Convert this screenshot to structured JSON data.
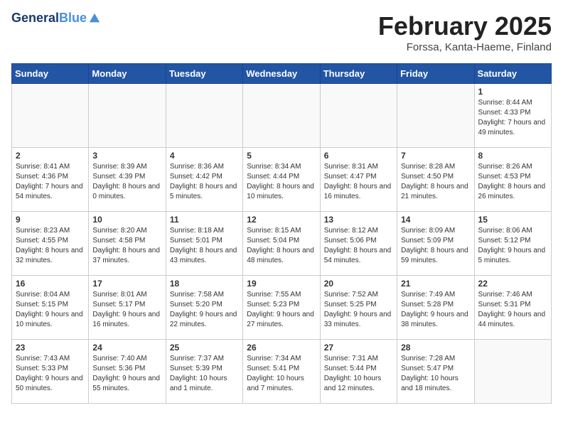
{
  "app": {
    "logo_line1": "General",
    "logo_line2": "Blue"
  },
  "calendar": {
    "title": "February 2025",
    "subtitle": "Forssa, Kanta-Haeme, Finland",
    "weekdays": [
      "Sunday",
      "Monday",
      "Tuesday",
      "Wednesday",
      "Thursday",
      "Friday",
      "Saturday"
    ],
    "weeks": [
      [
        {
          "day": "",
          "info": ""
        },
        {
          "day": "",
          "info": ""
        },
        {
          "day": "",
          "info": ""
        },
        {
          "day": "",
          "info": ""
        },
        {
          "day": "",
          "info": ""
        },
        {
          "day": "",
          "info": ""
        },
        {
          "day": "1",
          "info": "Sunrise: 8:44 AM\nSunset: 4:33 PM\nDaylight: 7 hours and 49 minutes."
        }
      ],
      [
        {
          "day": "2",
          "info": "Sunrise: 8:41 AM\nSunset: 4:36 PM\nDaylight: 7 hours and 54 minutes."
        },
        {
          "day": "3",
          "info": "Sunrise: 8:39 AM\nSunset: 4:39 PM\nDaylight: 8 hours and 0 minutes."
        },
        {
          "day": "4",
          "info": "Sunrise: 8:36 AM\nSunset: 4:42 PM\nDaylight: 8 hours and 5 minutes."
        },
        {
          "day": "5",
          "info": "Sunrise: 8:34 AM\nSunset: 4:44 PM\nDaylight: 8 hours and 10 minutes."
        },
        {
          "day": "6",
          "info": "Sunrise: 8:31 AM\nSunset: 4:47 PM\nDaylight: 8 hours and 16 minutes."
        },
        {
          "day": "7",
          "info": "Sunrise: 8:28 AM\nSunset: 4:50 PM\nDaylight: 8 hours and 21 minutes."
        },
        {
          "day": "8",
          "info": "Sunrise: 8:26 AM\nSunset: 4:53 PM\nDaylight: 8 hours and 26 minutes."
        }
      ],
      [
        {
          "day": "9",
          "info": "Sunrise: 8:23 AM\nSunset: 4:55 PM\nDaylight: 8 hours and 32 minutes."
        },
        {
          "day": "10",
          "info": "Sunrise: 8:20 AM\nSunset: 4:58 PM\nDaylight: 8 hours and 37 minutes."
        },
        {
          "day": "11",
          "info": "Sunrise: 8:18 AM\nSunset: 5:01 PM\nDaylight: 8 hours and 43 minutes."
        },
        {
          "day": "12",
          "info": "Sunrise: 8:15 AM\nSunset: 5:04 PM\nDaylight: 8 hours and 48 minutes."
        },
        {
          "day": "13",
          "info": "Sunrise: 8:12 AM\nSunset: 5:06 PM\nDaylight: 8 hours and 54 minutes."
        },
        {
          "day": "14",
          "info": "Sunrise: 8:09 AM\nSunset: 5:09 PM\nDaylight: 8 hours and 59 minutes."
        },
        {
          "day": "15",
          "info": "Sunrise: 8:06 AM\nSunset: 5:12 PM\nDaylight: 9 hours and 5 minutes."
        }
      ],
      [
        {
          "day": "16",
          "info": "Sunrise: 8:04 AM\nSunset: 5:15 PM\nDaylight: 9 hours and 10 minutes."
        },
        {
          "day": "17",
          "info": "Sunrise: 8:01 AM\nSunset: 5:17 PM\nDaylight: 9 hours and 16 minutes."
        },
        {
          "day": "18",
          "info": "Sunrise: 7:58 AM\nSunset: 5:20 PM\nDaylight: 9 hours and 22 minutes."
        },
        {
          "day": "19",
          "info": "Sunrise: 7:55 AM\nSunset: 5:23 PM\nDaylight: 9 hours and 27 minutes."
        },
        {
          "day": "20",
          "info": "Sunrise: 7:52 AM\nSunset: 5:25 PM\nDaylight: 9 hours and 33 minutes."
        },
        {
          "day": "21",
          "info": "Sunrise: 7:49 AM\nSunset: 5:28 PM\nDaylight: 9 hours and 38 minutes."
        },
        {
          "day": "22",
          "info": "Sunrise: 7:46 AM\nSunset: 5:31 PM\nDaylight: 9 hours and 44 minutes."
        }
      ],
      [
        {
          "day": "23",
          "info": "Sunrise: 7:43 AM\nSunset: 5:33 PM\nDaylight: 9 hours and 50 minutes."
        },
        {
          "day": "24",
          "info": "Sunrise: 7:40 AM\nSunset: 5:36 PM\nDaylight: 9 hours and 55 minutes."
        },
        {
          "day": "25",
          "info": "Sunrise: 7:37 AM\nSunset: 5:39 PM\nDaylight: 10 hours and 1 minute."
        },
        {
          "day": "26",
          "info": "Sunrise: 7:34 AM\nSunset: 5:41 PM\nDaylight: 10 hours and 7 minutes."
        },
        {
          "day": "27",
          "info": "Sunrise: 7:31 AM\nSunset: 5:44 PM\nDaylight: 10 hours and 12 minutes."
        },
        {
          "day": "28",
          "info": "Sunrise: 7:28 AM\nSunset: 5:47 PM\nDaylight: 10 hours and 18 minutes."
        },
        {
          "day": "",
          "info": ""
        }
      ]
    ]
  }
}
